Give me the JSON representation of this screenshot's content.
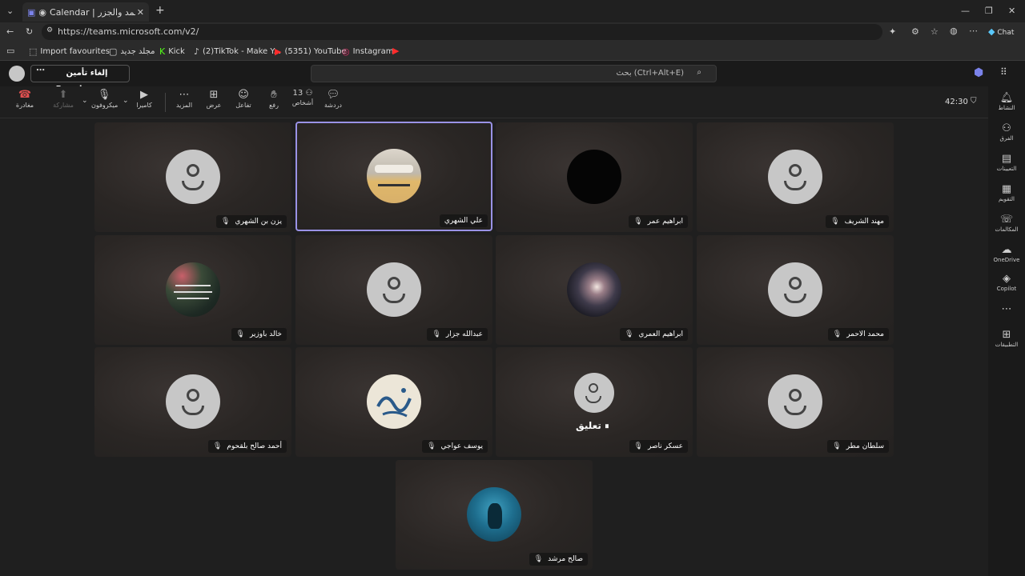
{
  "browser": {
    "tab_title": "Calendar | الأمواج والمد والجزر |",
    "url": "https://teams.microsoft.com/v2/",
    "chat_label": "Chat",
    "bookmarks": [
      {
        "label": "Import favourites",
        "icon": "import-icon"
      },
      {
        "label": "مجلد جديد",
        "icon": "folder-icon"
      },
      {
        "label": "Kick",
        "icon": "kick-icon"
      },
      {
        "label": "(2)TikTok - Make Y...",
        "icon": "tiktok-icon"
      },
      {
        "label": "(5351) YouTube",
        "icon": "youtube-icon"
      },
      {
        "label": "Instagram",
        "icon": "instagram-icon"
      }
    ]
  },
  "teams": {
    "premium_label": "إلغاء تأمين Premium",
    "search_placeholder": "بحث (Ctrl+Alt+E)",
    "timer": "42:30"
  },
  "toolbar": {
    "leave": "مغادرة",
    "share": "مشاركة",
    "mic": "ميكروفون",
    "camera": "كاميرا",
    "more": "المزيد",
    "view": "عرض",
    "react": "تفاعل",
    "raise": "رفع",
    "people": "أشخاص",
    "people_count": "13",
    "chat": "دردشة"
  },
  "rail": [
    {
      "label": "النشاط",
      "icon": "bell-icon"
    },
    {
      "label": "الفرق",
      "icon": "teams-icon"
    },
    {
      "label": "التعيينات",
      "icon": "assignments-icon"
    },
    {
      "label": "التقويم",
      "icon": "calendar-icon"
    },
    {
      "label": "المكالمات",
      "icon": "phone-icon"
    },
    {
      "label": "OneDrive",
      "icon": "cloud-icon"
    },
    {
      "label": "Copilot",
      "icon": "copilot-icon"
    },
    {
      "label": "التطبيقات",
      "icon": "apps-icon"
    }
  ],
  "participants": [
    {
      "name": "يزن بن الشهري",
      "avatar": "default"
    },
    {
      "name": "علي الشهري",
      "avatar": "photo-book"
    },
    {
      "name": "ابراهيم عمر",
      "avatar": "black"
    },
    {
      "name": "مهند الشريف",
      "avatar": "default"
    },
    {
      "name": "خالد باوزير",
      "avatar": "photo-roses"
    },
    {
      "name": "عبدالله جزار",
      "avatar": "default"
    },
    {
      "name": "ابراهيم العمري",
      "avatar": "photo-galaxy"
    },
    {
      "name": "محمد الاحمر",
      "avatar": "default"
    },
    {
      "name": "أحمد صالح بلقحوم",
      "avatar": "default"
    },
    {
      "name": "يوسف عواجي",
      "avatar": "photo-calligraphy"
    },
    {
      "name": "عسكر ناصر",
      "avatar": "default",
      "status": "تعليق"
    },
    {
      "name": "سلطان مطر",
      "avatar": "default"
    },
    {
      "name": "صالح مرشد",
      "avatar": "photo-ocean"
    }
  ]
}
